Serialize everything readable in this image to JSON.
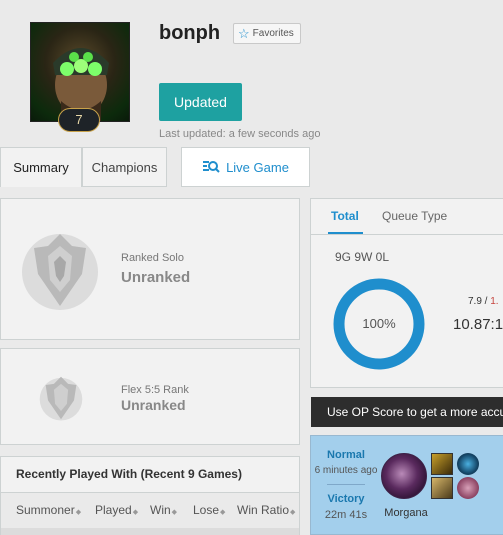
{
  "profile": {
    "summoner_name": "bonph",
    "level": "7",
    "favorites_label": "Favorites",
    "update_button": "Updated",
    "last_updated": "Last updated: a few seconds ago"
  },
  "tabs": [
    {
      "label": "Summary"
    },
    {
      "label": "Champions"
    },
    {
      "label": "Live Game"
    }
  ],
  "ranked_solo": {
    "label": "Ranked Solo",
    "value": "Unranked"
  },
  "flex_rank": {
    "label": "Flex 5:5 Rank",
    "value": "Unranked"
  },
  "recently_played": {
    "title": "Recently Played With (Recent 9 Games)",
    "columns": [
      "Summoner",
      "Played",
      "Win",
      "Lose",
      "Win Ratio"
    ]
  },
  "stats": {
    "tabs": [
      "Total",
      "Queue Type"
    ],
    "record": "9G 9W 0L",
    "win_rate_label": "100%",
    "win_rate": 100,
    "kda_small": "7.9 / 1.",
    "kda_big": "10.87:1"
  },
  "banner": {
    "text": "Use OP Score to get a more accu"
  },
  "game": {
    "type": "Normal",
    "time_ago": "6 minutes ago",
    "result": "Victory",
    "length": "22m 41s",
    "champion": "Morgana"
  },
  "colors": {
    "accent_teal": "#1ea1a1",
    "link_blue": "#1f8ecd",
    "win_card_bg": "#a3cfec",
    "death_red": "#c6443e"
  }
}
